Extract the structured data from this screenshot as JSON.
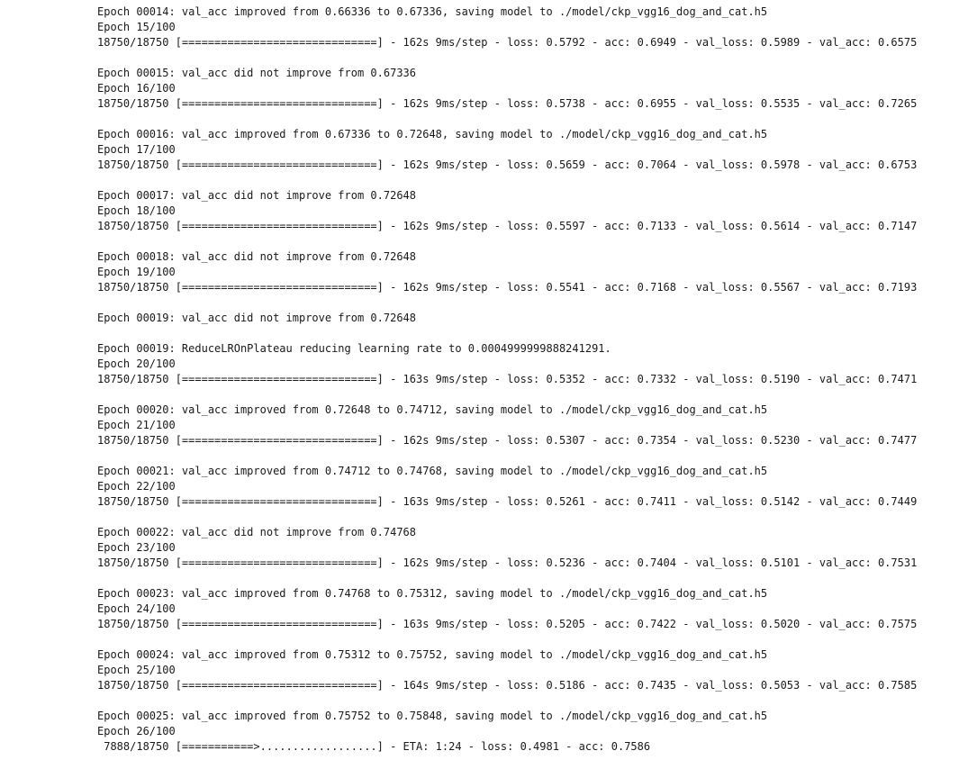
{
  "log_lines": [
    "Epoch 00014: val_acc improved from 0.66336 to 0.67336, saving model to ./model/ckp_vgg16_dog_and_cat.h5",
    "Epoch 15/100",
    "18750/18750 [==============================] - 162s 9ms/step - loss: 0.5792 - acc: 0.6949 - val_loss: 0.5989 - val_acc: 0.6575",
    "",
    "Epoch 00015: val_acc did not improve from 0.67336",
    "Epoch 16/100",
    "18750/18750 [==============================] - 162s 9ms/step - loss: 0.5738 - acc: 0.6955 - val_loss: 0.5535 - val_acc: 0.7265",
    "",
    "Epoch 00016: val_acc improved from 0.67336 to 0.72648, saving model to ./model/ckp_vgg16_dog_and_cat.h5",
    "Epoch 17/100",
    "18750/18750 [==============================] - 162s 9ms/step - loss: 0.5659 - acc: 0.7064 - val_loss: 0.5978 - val_acc: 0.6753",
    "",
    "Epoch 00017: val_acc did not improve from 0.72648",
    "Epoch 18/100",
    "18750/18750 [==============================] - 162s 9ms/step - loss: 0.5597 - acc: 0.7133 - val_loss: 0.5614 - val_acc: 0.7147",
    "",
    "Epoch 00018: val_acc did not improve from 0.72648",
    "Epoch 19/100",
    "18750/18750 [==============================] - 162s 9ms/step - loss: 0.5541 - acc: 0.7168 - val_loss: 0.5567 - val_acc: 0.7193",
    "",
    "Epoch 00019: val_acc did not improve from 0.72648",
    "",
    "Epoch 00019: ReduceLROnPlateau reducing learning rate to 0.0004999999888241291.",
    "Epoch 20/100",
    "18750/18750 [==============================] - 163s 9ms/step - loss: 0.5352 - acc: 0.7332 - val_loss: 0.5190 - val_acc: 0.7471",
    "",
    "Epoch 00020: val_acc improved from 0.72648 to 0.74712, saving model to ./model/ckp_vgg16_dog_and_cat.h5",
    "Epoch 21/100",
    "18750/18750 [==============================] - 162s 9ms/step - loss: 0.5307 - acc: 0.7354 - val_loss: 0.5230 - val_acc: 0.7477",
    "",
    "Epoch 00021: val_acc improved from 0.74712 to 0.74768, saving model to ./model/ckp_vgg16_dog_and_cat.h5",
    "Epoch 22/100",
    "18750/18750 [==============================] - 163s 9ms/step - loss: 0.5261 - acc: 0.7411 - val_loss: 0.5142 - val_acc: 0.7449",
    "",
    "Epoch 00022: val_acc did not improve from 0.74768",
    "Epoch 23/100",
    "18750/18750 [==============================] - 162s 9ms/step - loss: 0.5236 - acc: 0.7404 - val_loss: 0.5101 - val_acc: 0.7531",
    "",
    "Epoch 00023: val_acc improved from 0.74768 to 0.75312, saving model to ./model/ckp_vgg16_dog_and_cat.h5",
    "Epoch 24/100",
    "18750/18750 [==============================] - 163s 9ms/step - loss: 0.5205 - acc: 0.7422 - val_loss: 0.5020 - val_acc: 0.7575",
    "",
    "Epoch 00024: val_acc improved from 0.75312 to 0.75752, saving model to ./model/ckp_vgg16_dog_and_cat.h5",
    "Epoch 25/100",
    "18750/18750 [==============================] - 164s 9ms/step - loss: 0.5186 - acc: 0.7435 - val_loss: 0.5053 - val_acc: 0.7585",
    "",
    "Epoch 00025: val_acc improved from 0.75752 to 0.75848, saving model to ./model/ckp_vgg16_dog_and_cat.h5",
    "Epoch 26/100",
    " 7888/18750 [===========>..................] - ETA: 1:24 - loss: 0.4981 - acc: 0.7586"
  ],
  "colors": {
    "background": "#ffffff",
    "text": "#1a1a1a"
  }
}
